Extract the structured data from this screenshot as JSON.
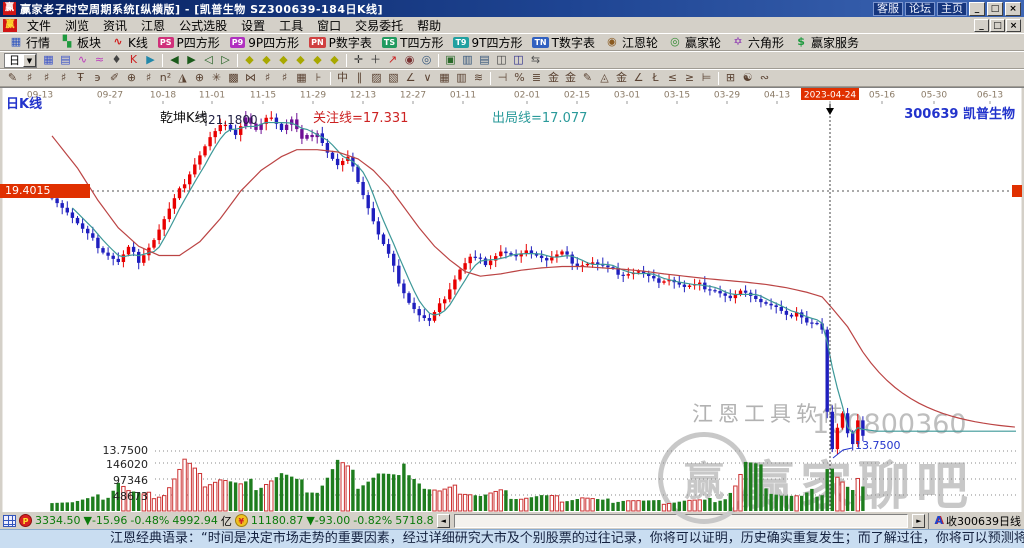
{
  "window": {
    "logo": "赢",
    "title": "赢家老子时空周期系统[纵横版] - [凯普生物  SZ300639-184日K线]",
    "links": [
      "客服",
      "论坛",
      "主页"
    ],
    "controls": [
      "_",
      "□",
      "×"
    ]
  },
  "menu": {
    "items": [
      "文件",
      "浏览",
      "资讯",
      "江恩",
      "公式选股",
      "设置",
      "工具",
      "窗口",
      "交易委托",
      "帮助"
    ]
  },
  "toolbar1": {
    "items": [
      {
        "g": "▦",
        "c": "#2a52c0",
        "label": "行情"
      },
      {
        "g": "▚",
        "c": "#1f9a3f",
        "label": "板块"
      },
      {
        "g": "∿",
        "c": "#d02020",
        "label": "K线"
      },
      {
        "b": "PS",
        "c": "#d0307a",
        "label": "P四方形"
      },
      {
        "b": "P9",
        "c": "#b030c0",
        "label": "9P四方形"
      },
      {
        "b": "PN",
        "c": "#d04040",
        "label": "P数字表"
      },
      {
        "b": "TS",
        "c": "#1f9a5f",
        "label": "T四方形"
      },
      {
        "b": "T9",
        "c": "#20a0a0",
        "label": "9T四方形"
      },
      {
        "b": "TN",
        "c": "#3060c0",
        "label": "T数字表"
      },
      {
        "g": "◉",
        "c": "#8a5a20",
        "label": "江恩轮"
      },
      {
        "g": "◎",
        "c": "#2f8a2f",
        "label": "赢家轮"
      },
      {
        "g": "✡",
        "c": "#8a30b0",
        "label": "六角形"
      },
      {
        "g": "$",
        "c": "#1f9a3f",
        "label": "赢家服务"
      }
    ]
  },
  "toolbar2": {
    "period": "日",
    "items": [
      {
        "g": "▦",
        "c": "#3a52c8"
      },
      {
        "g": "▤",
        "c": "#3a52c8"
      },
      {
        "g": "∿",
        "c": "#bb39bb"
      },
      {
        "g": "≈",
        "c": "#bb39bb"
      },
      {
        "g": "♦",
        "c": "#444444"
      },
      {
        "g": "K",
        "c": "#cc2222"
      },
      {
        "g": "▶",
        "c": "#2288aa"
      },
      {
        "sep": 1
      },
      {
        "g": "◀",
        "c": "#1a5a1a"
      },
      {
        "g": "▶",
        "c": "#1a5a1a"
      },
      {
        "g": "◁",
        "c": "#1a5a1a"
      },
      {
        "g": "▷",
        "c": "#1a5a1a"
      },
      {
        "sep": 1
      },
      {
        "g": "◆",
        "c": "#a8a800"
      },
      {
        "g": "◆",
        "c": "#a8a800"
      },
      {
        "g": "◆",
        "c": "#a8a800"
      },
      {
        "g": "◆",
        "c": "#a8a800"
      },
      {
        "g": "◆",
        "c": "#a8a800"
      },
      {
        "g": "◆",
        "c": "#a8a800"
      },
      {
        "sep": 1
      },
      {
        "g": "✛",
        "c": "#333333"
      },
      {
        "g": "＋",
        "c": "#333333"
      },
      {
        "g": "↗",
        "c": "#cc2222"
      },
      {
        "g": "◉",
        "c": "#7a3333"
      },
      {
        "g": "◎",
        "c": "#33557a"
      },
      {
        "sep": 1
      },
      {
        "g": "▣",
        "c": "#2a6a2a"
      },
      {
        "g": "▥",
        "c": "#33557a"
      },
      {
        "g": "▤",
        "c": "#33557a"
      },
      {
        "g": "◫",
        "c": "#444444"
      },
      {
        "g": "◫",
        "c": "#2a2a8a"
      },
      {
        "g": "⇆",
        "c": "#555555"
      }
    ]
  },
  "toolbar3": {
    "items": [
      "✎",
      "♯",
      "♯",
      "♯",
      "Ŧ",
      "϶",
      "✐",
      "⊕",
      "♯",
      "n²",
      "◮",
      "⊕",
      "✳",
      "▩",
      "⋈",
      "♯",
      "♯",
      "▦",
      "⊦",
      "|",
      "中",
      "∥",
      "▨",
      "▧",
      "∠",
      "∨",
      "▦",
      "▥",
      "≋",
      "|",
      "⊣",
      "%",
      "≣",
      "金",
      "金",
      "✎",
      "◬",
      "金",
      "∠",
      "Ł",
      "≤",
      "≥",
      "⊨",
      "|",
      "⊞",
      "☯",
      "∾"
    ]
  },
  "chart": {
    "labels": {
      "kline": "日K线",
      "indicator": "乾坤K线",
      "watch": "关注线=17.331",
      "exit": "出局线=17.077",
      "peak": "21.1800",
      "watchline": "19.4015",
      "stock": "300639 凯普生物",
      "low_left": "13.7500",
      "low_right": "13.7500",
      "vol1": "146020",
      "vol2": "97346",
      "vol3": "48673",
      "wm1": "江恩工具软件",
      "wm2": "100800360",
      "wm3": "赢家聊吧",
      "wmlogo": "赢"
    }
  },
  "chart_data": {
    "type": "candlestick",
    "symbol": "SZ300639",
    "name": "凯普生物",
    "period": "日K线",
    "n": 160,
    "colors": {
      "up": "#e80000",
      "down": "#1f1fbe",
      "special": "#6e0f95",
      "ma_short": "#3d9898",
      "ma_long": "#bb4444",
      "vol_up": "#cc3333",
      "vol_down": "#1e7d1e"
    },
    "y_marks": {
      "watch_line": 19.4015,
      "peak": 21.18,
      "low": 13.75
    },
    "indicator": {
      "name": "乾坤K线",
      "watch": 17.331,
      "exit": 17.077
    },
    "volume_axis": [
      146020,
      97346,
      48673
    ],
    "highlight_date": "2023-04-24",
    "date_ticks": [
      [
        40,
        "09-13"
      ],
      [
        110,
        "09-27"
      ],
      [
        163,
        "10-18"
      ],
      [
        212,
        "11-01"
      ],
      [
        263,
        "11-15"
      ],
      [
        313,
        "11-29"
      ],
      [
        363,
        "12-13"
      ],
      [
        413,
        "12-27"
      ],
      [
        463,
        "01-11"
      ],
      [
        527,
        "02-01"
      ],
      [
        577,
        "02-15"
      ],
      [
        627,
        "03-01"
      ],
      [
        677,
        "03-15"
      ],
      [
        727,
        "03-29"
      ],
      [
        777,
        "04-13"
      ],
      [
        830,
        "2023-04-24"
      ],
      [
        882,
        "05-16"
      ],
      [
        934,
        "05-30"
      ],
      [
        990,
        "06-13"
      ]
    ],
    "close_keyframes": [
      [
        0,
        19.3
      ],
      [
        3,
        18.95
      ],
      [
        6,
        18.55
      ],
      [
        10,
        18.1
      ],
      [
        13,
        17.85
      ],
      [
        15,
        18.15
      ],
      [
        17,
        17.9
      ],
      [
        20,
        18.35
      ],
      [
        24,
        19.2
      ],
      [
        28,
        20.0
      ],
      [
        31,
        20.55
      ],
      [
        34,
        20.9
      ],
      [
        36,
        20.65
      ],
      [
        38,
        21.0
      ],
      [
        40,
        20.7
      ],
      [
        43,
        21.05
      ],
      [
        45,
        20.75
      ],
      [
        47,
        20.95
      ],
      [
        49,
        20.5
      ],
      [
        52,
        20.7
      ],
      [
        54,
        20.25
      ],
      [
        56,
        19.95
      ],
      [
        58,
        20.1
      ],
      [
        60,
        19.65
      ],
      [
        62,
        19.05
      ],
      [
        64,
        18.45
      ],
      [
        66,
        18.0
      ],
      [
        68,
        17.45
      ],
      [
        70,
        17.0
      ],
      [
        72,
        16.7
      ],
      [
        74,
        16.55
      ],
      [
        76,
        16.9
      ],
      [
        78,
        17.3
      ],
      [
        80,
        17.7
      ],
      [
        82,
        17.95
      ],
      [
        85,
        17.85
      ],
      [
        88,
        18.1
      ],
      [
        91,
        17.95
      ],
      [
        94,
        18.1
      ],
      [
        97,
        17.9
      ],
      [
        100,
        18.05
      ],
      [
        103,
        17.8
      ],
      [
        106,
        17.85
      ],
      [
        109,
        17.7
      ],
      [
        112,
        17.6
      ],
      [
        115,
        17.65
      ],
      [
        118,
        17.45
      ],
      [
        121,
        17.5
      ],
      [
        124,
        17.3
      ],
      [
        127,
        17.35
      ],
      [
        130,
        17.25
      ],
      [
        133,
        17.05
      ],
      [
        136,
        17.25
      ],
      [
        139,
        17.0
      ],
      [
        142,
        16.85
      ],
      [
        144,
        16.65
      ],
      [
        146,
        16.8
      ],
      [
        148,
        16.55
      ],
      [
        150,
        16.5
      ],
      [
        151,
        16.35
      ],
      [
        152,
        14.55
      ],
      [
        153,
        13.85
      ],
      [
        154,
        14.3
      ],
      [
        155,
        14.6
      ],
      [
        156,
        14.15
      ],
      [
        157,
        13.9
      ],
      [
        158,
        14.4
      ],
      [
        159,
        14.05
      ]
    ],
    "volume_keyframes": [
      [
        0,
        32000
      ],
      [
        4,
        28000
      ],
      [
        8,
        38000
      ],
      [
        11,
        50000
      ],
      [
        13,
        95000
      ],
      [
        15,
        62000
      ],
      [
        18,
        45000
      ],
      [
        22,
        55000
      ],
      [
        26,
        150000
      ],
      [
        29,
        95000
      ],
      [
        33,
        105000
      ],
      [
        37,
        75000
      ],
      [
        41,
        88000
      ],
      [
        45,
        115000
      ],
      [
        48,
        85000
      ],
      [
        52,
        65000
      ],
      [
        56,
        148000
      ],
      [
        60,
        90000
      ],
      [
        64,
        120000
      ],
      [
        68,
        95000
      ],
      [
        70,
        145000
      ],
      [
        73,
        75000
      ],
      [
        76,
        58000
      ],
      [
        80,
        68000
      ],
      [
        84,
        48000
      ],
      [
        88,
        56000
      ],
      [
        92,
        42000
      ],
      [
        96,
        46000
      ],
      [
        100,
        36000
      ],
      [
        104,
        42000
      ],
      [
        108,
        30000
      ],
      [
        112,
        36000
      ],
      [
        116,
        30000
      ],
      [
        120,
        27000
      ],
      [
        124,
        33000
      ],
      [
        128,
        30000
      ],
      [
        132,
        42000
      ],
      [
        134,
        80000
      ],
      [
        136,
        142000
      ],
      [
        139,
        118000
      ],
      [
        141,
        65000
      ],
      [
        143,
        52000
      ],
      [
        145,
        46000
      ],
      [
        147,
        42000
      ],
      [
        149,
        56000
      ],
      [
        151,
        60000
      ],
      [
        152,
        150000
      ],
      [
        153,
        143000
      ],
      [
        154,
        108000
      ],
      [
        155,
        88000
      ],
      [
        156,
        70000
      ],
      [
        157,
        58000
      ],
      [
        158,
        86000
      ],
      [
        159,
        62000
      ]
    ],
    "red_ma_keyframes": [
      [
        0,
        20.6
      ],
      [
        5,
        19.9
      ],
      [
        9,
        19.2
      ],
      [
        13,
        18.6
      ],
      [
        17,
        18.2
      ],
      [
        21,
        18.0
      ],
      [
        25,
        18.0
      ],
      [
        29,
        18.3
      ],
      [
        33,
        18.8
      ],
      [
        37,
        19.4
      ],
      [
        41,
        19.85
      ],
      [
        45,
        20.15
      ],
      [
        48,
        20.3
      ],
      [
        52,
        20.3
      ],
      [
        56,
        20.25
      ],
      [
        60,
        20.1
      ],
      [
        63,
        19.85
      ],
      [
        66,
        19.5
      ],
      [
        69,
        19.05
      ],
      [
        72,
        18.6
      ],
      [
        75,
        18.2
      ],
      [
        78,
        17.9
      ],
      [
        81,
        17.65
      ],
      [
        84,
        17.55
      ],
      [
        88,
        17.6
      ],
      [
        92,
        17.68
      ],
      [
        96,
        17.73
      ],
      [
        100,
        17.76
      ],
      [
        104,
        17.76
      ],
      [
        108,
        17.73
      ],
      [
        112,
        17.7
      ],
      [
        116,
        17.66
      ],
      [
        120,
        17.6
      ],
      [
        124,
        17.55
      ],
      [
        128,
        17.5
      ],
      [
        132,
        17.46
      ],
      [
        136,
        17.42
      ],
      [
        140,
        17.37
      ],
      [
        144,
        17.3
      ],
      [
        148,
        17.2
      ],
      [
        151,
        17.1
      ],
      [
        153,
        16.85
      ],
      [
        156,
        16.45
      ],
      [
        159,
        15.9
      ]
    ],
    "purple_ranges": [
      [
        38,
        41
      ],
      [
        46,
        52
      ]
    ],
    "projection": {
      "teal_flat": 14.18,
      "red_target": 14.16,
      "red_tau": 55
    }
  },
  "statusbar": {
    "sh": {
      "value": "3334.50",
      "change": "▼-15.96",
      "pct": "-0.48%",
      "amount": "4992.94",
      "unit": "亿"
    },
    "sz": {
      "value": "11180.87",
      "change": "▼-93.00",
      "pct": "-0.82%",
      "amount": "5718.8"
    },
    "a_icon": "A",
    "right_label": "收300639日线"
  },
  "quote": "江恩经典语录：“时间是决定市场走势的重要因素，经过详细研究大市及个别股票的过往记录，你将可以证明，历史确实重复发生；而了解过往，你将可以预测将来。”。"
}
